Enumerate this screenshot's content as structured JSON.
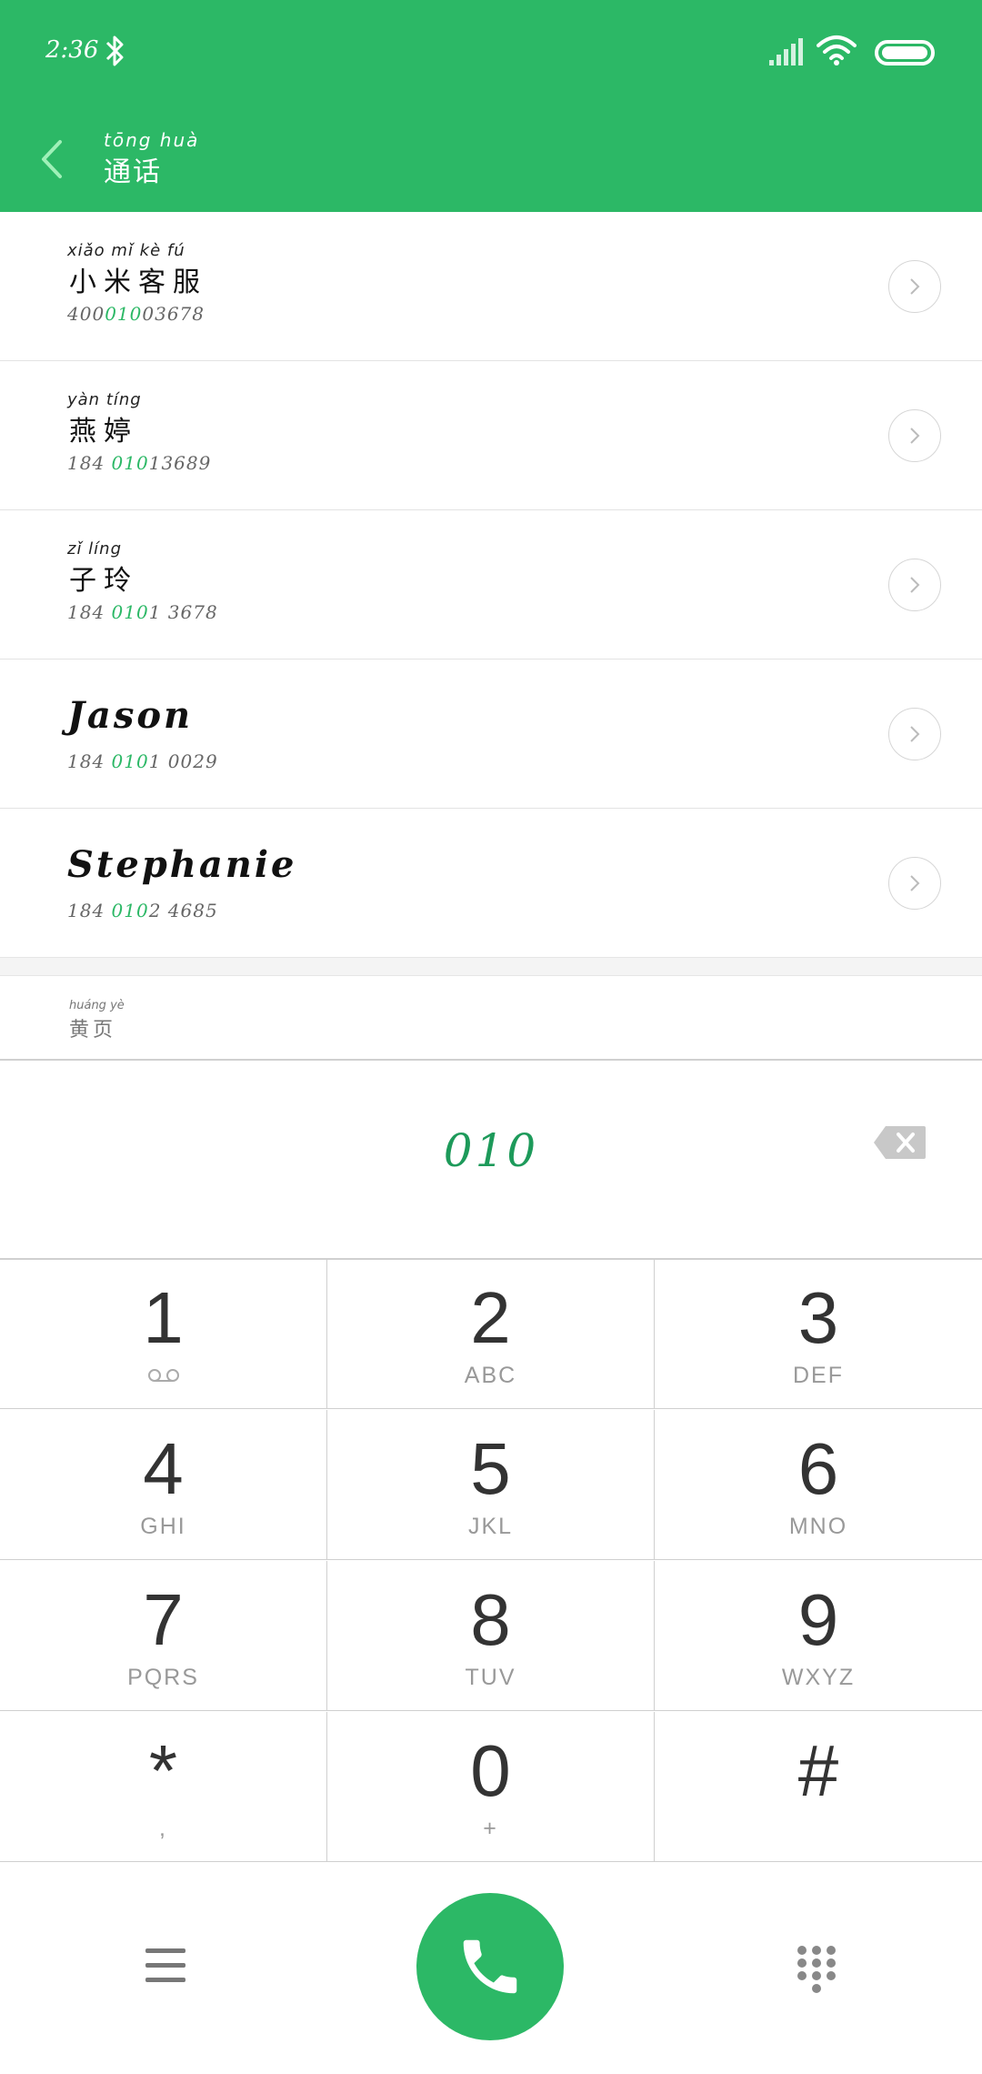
{
  "status_bar": {
    "time": "2:36"
  },
  "app_bar": {
    "title_pinyin": "tōng huà",
    "title": "通话"
  },
  "contacts": [
    {
      "pinyin": "xiǎo mǐ kè fú",
      "name": "小米客服",
      "number_pre": "400",
      "number_match": "010",
      "number_post": "03678"
    },
    {
      "pinyin": "yàn tíng",
      "name": "燕婷",
      "number_pre": "184 ",
      "number_match": "010",
      "number_post": "13689"
    },
    {
      "pinyin": "zǐ líng",
      "name": "子玲",
      "number_pre": "184 ",
      "number_match": "010",
      "number_post": "1 3678"
    },
    {
      "name": "Jason",
      "number_pre": "184 ",
      "number_match": "010",
      "number_post": "1 0029"
    },
    {
      "name": "Stephanie",
      "number_pre": "184 ",
      "number_match": "010",
      "number_post": "2 4685"
    }
  ],
  "partial_contact": {
    "pinyin": "huáng yè",
    "name": "黄页"
  },
  "display": {
    "digits": "010"
  },
  "keypad": [
    {
      "num": "1",
      "sub": ""
    },
    {
      "num": "2",
      "sub": "ABC"
    },
    {
      "num": "3",
      "sub": "DEF"
    },
    {
      "num": "4",
      "sub": "GHI"
    },
    {
      "num": "5",
      "sub": "JKL"
    },
    {
      "num": "6",
      "sub": "MNO"
    },
    {
      "num": "7",
      "sub": "PQRS"
    },
    {
      "num": "8",
      "sub": "TUV"
    },
    {
      "num": "9",
      "sub": "WXYZ"
    },
    {
      "num": "*",
      "sub": ","
    },
    {
      "num": "0",
      "sub": "+"
    },
    {
      "num": "#",
      "sub": ""
    }
  ],
  "icons": {
    "bluetooth": "bluetooth-icon",
    "signal": "signal-icon",
    "wifi": "wifi-icon",
    "battery": "battery-icon",
    "back": "back-arrow-icon",
    "detail": "chevron-right-icon",
    "voicemail": "voicemail-icon",
    "backspace": "backspace-icon",
    "menu": "menu-icon",
    "call": "phone-icon",
    "dialpad": "dialpad-icon"
  },
  "colors": {
    "accent": "#2cb866",
    "highlight": "#1d9a5a"
  }
}
